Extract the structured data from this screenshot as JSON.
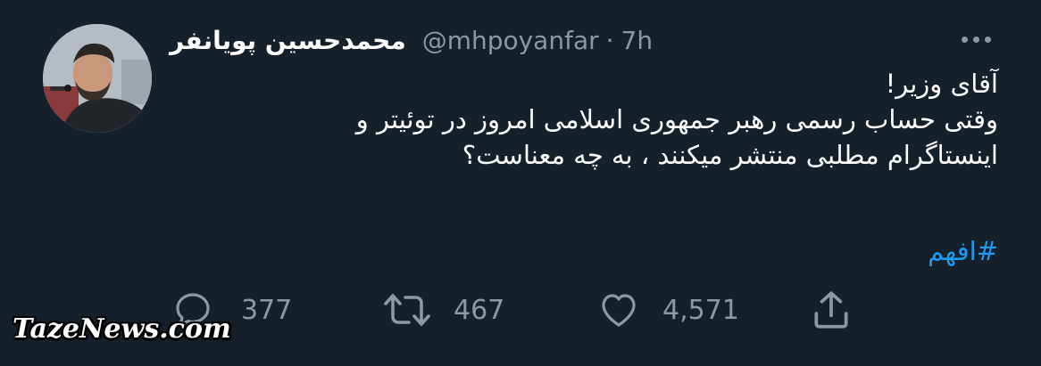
{
  "tweet": {
    "display_name": "محمدحسین پویانفر",
    "handle": "@mhpoyanfar",
    "separator": "·",
    "time": "7h",
    "text_lines": [
      "آقای وزیر!",
      "وقتی حساب رسمی رهبر جمهوری اسلامی امروز در توئیتر و",
      "اینستاگرام مطلبی منتشر میکنند ، به چه معناست؟"
    ],
    "hashtag": "#افهم"
  },
  "actions": {
    "replies": "377",
    "retweets": "467",
    "likes": "4,571"
  },
  "icons": {
    "more": "more-horizontal-icon",
    "reply": "reply-icon",
    "retweet": "retweet-icon",
    "like": "heart-icon",
    "share": "share-icon"
  },
  "colors": {
    "background": "#15202b",
    "muted": "#8b98a5",
    "accent": "#1d9bf0"
  },
  "watermark": "TazeNews.com"
}
